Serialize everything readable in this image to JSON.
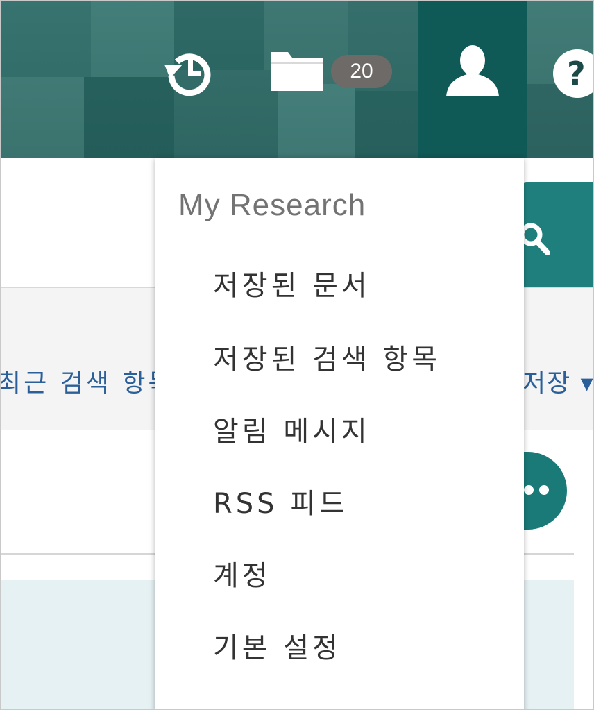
{
  "header": {
    "folder_count": "20",
    "help_symbol": "?",
    "icons": {
      "history": "history-icon",
      "folder": "folder-icon",
      "user": "user-icon",
      "help": "help-icon"
    }
  },
  "search": {
    "input_value": "",
    "placeholder": "",
    "button_icon": "search-icon"
  },
  "nav": {
    "recent_searches_label": "최근 검색 항목",
    "saved_label": "저장 ▾"
  },
  "dropdown": {
    "heading": "My Research",
    "items": [
      "저장된 문서",
      "저장된 검색 항목",
      "알림 메시지",
      "RSS 피드",
      "계정",
      "기본 설정"
    ]
  },
  "colors": {
    "header_teal": "#2f6d69",
    "active_tab": "#0f5956",
    "accent": "#1f7f7d",
    "badge": "#6e6a67",
    "link": "#2a5f9a",
    "panel": "#e5f1f3"
  }
}
